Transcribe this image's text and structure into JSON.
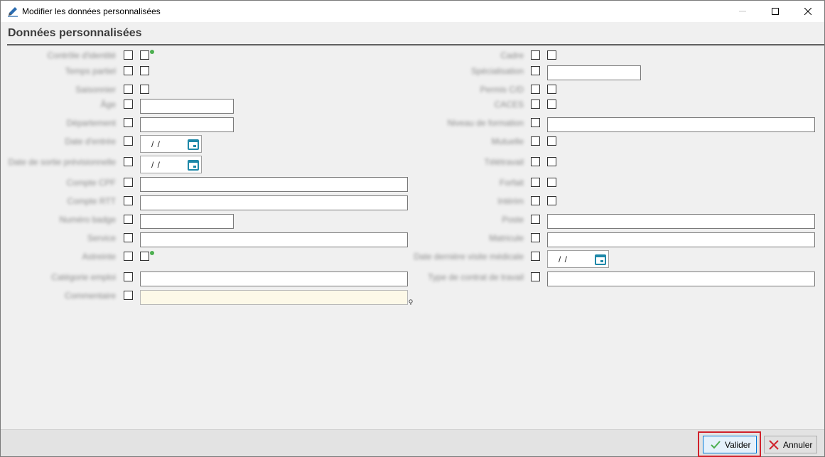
{
  "window": {
    "title": "Modifier les données personnalisées"
  },
  "section": {
    "title": "Données personnalisées"
  },
  "left_fields": [
    {
      "label": "Contrôle d'identité",
      "type": "checkbox"
    },
    {
      "label": "Temps partiel",
      "type": "checkbox"
    },
    {
      "label": "Saisonnier",
      "type": "checkbox"
    },
    {
      "label": "Âge",
      "type": "text",
      "value": ""
    },
    {
      "label": "Département",
      "type": "text",
      "value": ""
    },
    {
      "label": "Date d'entrée",
      "type": "date",
      "value": "/ /"
    },
    {
      "label": "Date de sortie prévisionnelle",
      "type": "date",
      "value": "/ /"
    },
    {
      "label": "Compte CPF",
      "type": "text",
      "value": ""
    },
    {
      "label": "Compte RTT",
      "type": "text",
      "value": ""
    },
    {
      "label": "Numéro badge",
      "type": "text",
      "value": ""
    },
    {
      "label": "Service",
      "type": "text",
      "value": ""
    },
    {
      "label": "Astreinte",
      "type": "checkbox"
    },
    {
      "label": "Catégorie emploi",
      "type": "text",
      "value": ""
    },
    {
      "label": "Commentaire",
      "type": "text",
      "value": ""
    }
  ],
  "right_fields": [
    {
      "label": "Cadre",
      "type": "checkbox"
    },
    {
      "label": "Spécialisation",
      "type": "text",
      "value": ""
    },
    {
      "label": "Permis C/D",
      "type": "checkbox"
    },
    {
      "label": "CACES",
      "type": "checkbox"
    },
    {
      "label": "Niveau de formation",
      "type": "text",
      "value": ""
    },
    {
      "label": "Mutuelle",
      "type": "checkbox"
    },
    {
      "label": "Télétravail",
      "type": "checkbox"
    },
    {
      "label": "Forfait",
      "type": "checkbox"
    },
    {
      "label": "Intérim",
      "type": "checkbox"
    },
    {
      "label": "Poste",
      "type": "text",
      "value": ""
    },
    {
      "label": "Matricule",
      "type": "text",
      "value": ""
    },
    {
      "label": "Date dernière visite médicale",
      "type": "date",
      "value": "/ /"
    },
    {
      "label": "Type de contrat de travail",
      "type": "text",
      "value": ""
    }
  ],
  "footer": {
    "validate_label": "Valider",
    "cancel_label": "Annuler"
  },
  "colors": {
    "validate_outline": "#d0212b",
    "calendar_icon": "#1e88a8",
    "green_status": "#4caf50"
  }
}
